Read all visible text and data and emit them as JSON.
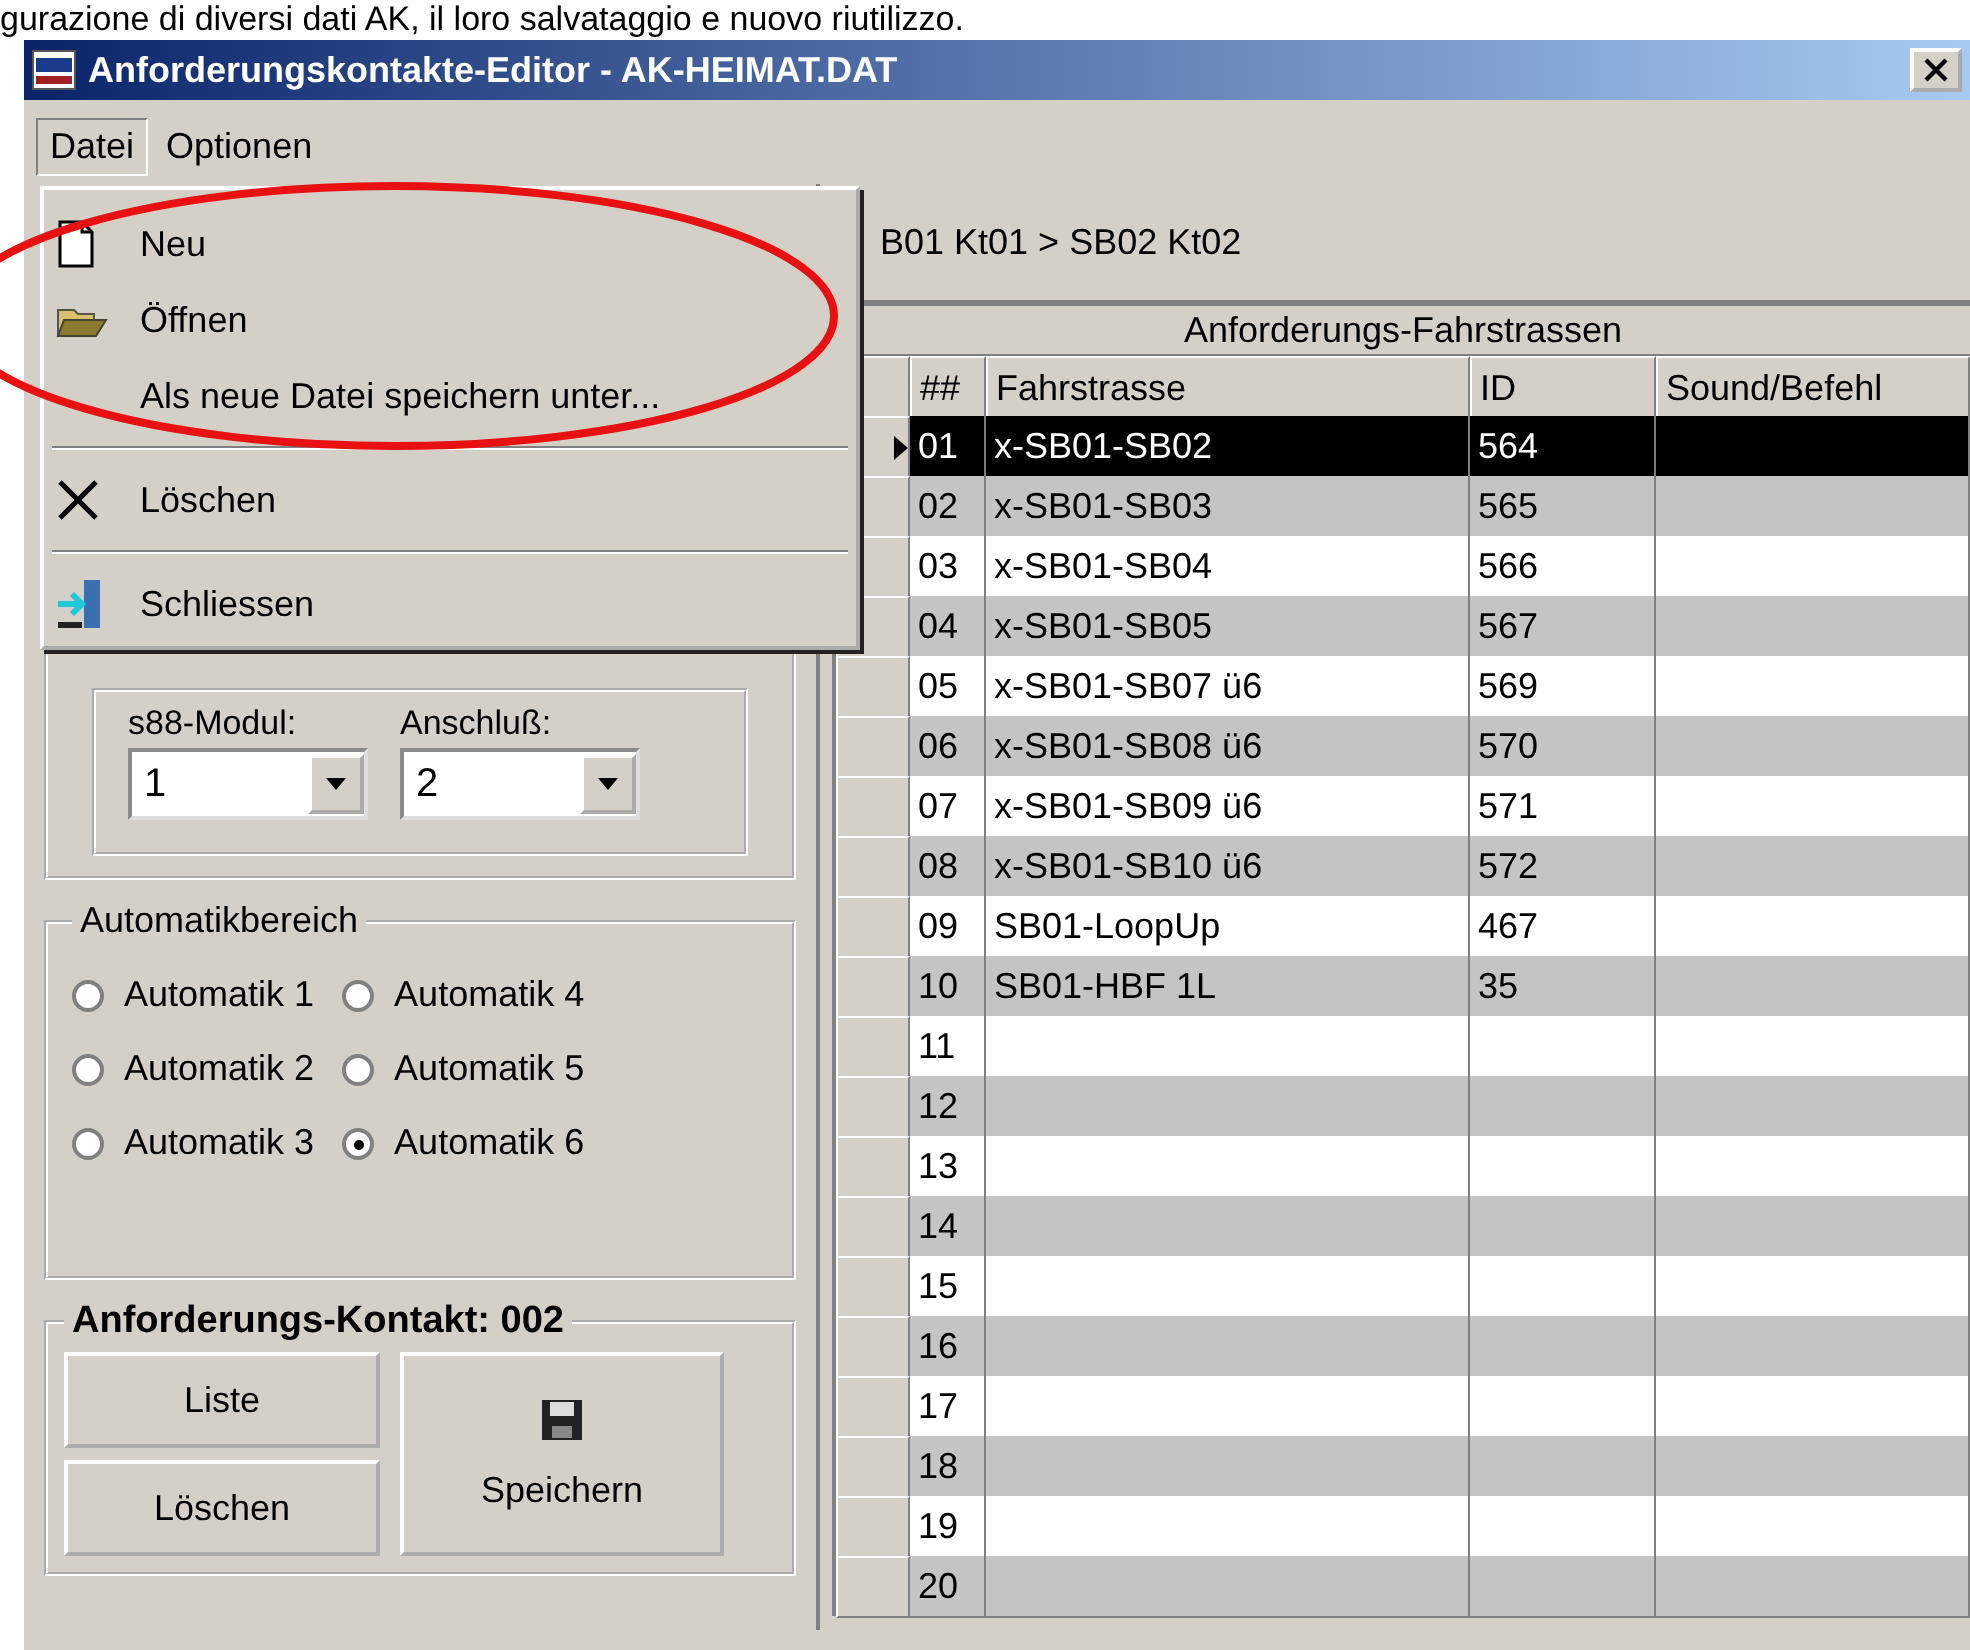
{
  "caption": "gurazione di diversi dati AK, il loro salvataggio e nuovo riutilizzo.",
  "window": {
    "title": "Anforderungskontakte-Editor - AK-HEIMAT.DAT"
  },
  "menu_bar": [
    {
      "label": "Datei",
      "selected": true
    },
    {
      "label": "Optionen",
      "selected": false
    }
  ],
  "dropdown": {
    "groups": [
      [
        {
          "label": "Neu"
        },
        {
          "label": "Öffnen"
        },
        {
          "label": "Als neue Datei speichern unter..."
        }
      ],
      [
        {
          "label": "Löschen"
        }
      ],
      [
        {
          "label": "Schliessen"
        }
      ]
    ]
  },
  "route": "B01 Kt01 > SB02 Kt02",
  "contact_group": {
    "module_label": "s88-Modul:",
    "module_value": "1",
    "port_label": "Anschluß:",
    "port_value": "2"
  },
  "automatic_group": {
    "title": "Automatikbereich",
    "options": [
      {
        "label": "Automatik 1",
        "selected": false
      },
      {
        "label": "Automatik 2",
        "selected": false
      },
      {
        "label": "Automatik 3",
        "selected": false
      },
      {
        "label": "Automatik 4",
        "selected": false
      },
      {
        "label": "Automatik 5",
        "selected": false
      },
      {
        "label": "Automatik 6",
        "selected": true
      }
    ]
  },
  "action_group": {
    "title": "Anforderungs-Kontakt: 002",
    "buttons": [
      "Liste",
      "Löschen"
    ],
    "save_button": "Speichern"
  },
  "table": {
    "title": "Anforderungs-Fahrstrassen",
    "columns": [
      "##",
      "Fahrstrasse",
      "ID",
      "Sound/Befehl"
    ],
    "rows": [
      {
        "cells": [
          "01",
          "x-SB01-SB02",
          "564",
          ""
        ],
        "selected": true
      },
      {
        "cells": [
          "02",
          "x-SB01-SB03",
          "565",
          ""
        ],
        "selected": false
      },
      {
        "cells": [
          "03",
          "x-SB01-SB04",
          "566",
          ""
        ],
        "selected": false
      },
      {
        "cells": [
          "04",
          "x-SB01-SB05",
          "567",
          ""
        ],
        "selected": false
      },
      {
        "cells": [
          "05",
          "x-SB01-SB07 ü6",
          "569",
          ""
        ],
        "selected": false
      },
      {
        "cells": [
          "06",
          "x-SB01-SB08 ü6",
          "570",
          ""
        ],
        "selected": false
      },
      {
        "cells": [
          "07",
          "x-SB01-SB09 ü6",
          "571",
          ""
        ],
        "selected": false
      },
      {
        "cells": [
          "08",
          "x-SB01-SB10 ü6",
          "572",
          ""
        ],
        "selected": false
      },
      {
        "cells": [
          "09",
          "SB01-LoopUp",
          "467",
          ""
        ],
        "selected": false
      },
      {
        "cells": [
          "10",
          "SB01-HBF 1L",
          "35",
          ""
        ],
        "selected": false
      },
      {
        "cells": [
          "11",
          "",
          "",
          ""
        ],
        "selected": false
      },
      {
        "cells": [
          "12",
          "",
          "",
          ""
        ],
        "selected": false
      },
      {
        "cells": [
          "13",
          "",
          "",
          ""
        ],
        "selected": false
      },
      {
        "cells": [
          "14",
          "",
          "",
          ""
        ],
        "selected": false
      },
      {
        "cells": [
          "15",
          "",
          "",
          ""
        ],
        "selected": false
      },
      {
        "cells": [
          "16",
          "",
          "",
          ""
        ],
        "selected": false
      },
      {
        "cells": [
          "17",
          "",
          "",
          ""
        ],
        "selected": false
      },
      {
        "cells": [
          "18",
          "",
          "",
          ""
        ],
        "selected": false
      },
      {
        "cells": [
          "19",
          "",
          "",
          ""
        ],
        "selected": false
      },
      {
        "cells": [
          "20",
          "",
          "",
          ""
        ],
        "selected": false
      }
    ]
  }
}
